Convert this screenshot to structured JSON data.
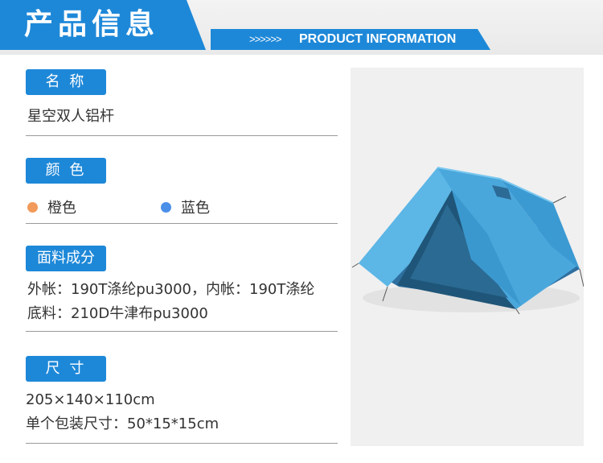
{
  "header": {
    "title": "产品信息",
    "arrows": ">>>>>>",
    "subtitle": "PRODUCT INFORMATION",
    "color": "#1e88d8"
  },
  "sections": {
    "name": {
      "label": "名 称",
      "value": "星空双人铝杆"
    },
    "color": {
      "label": "颜 色",
      "options": [
        {
          "name": "橙色",
          "swatch": "#f29a5a"
        },
        {
          "name": "蓝色",
          "swatch": "#4a8fe8"
        }
      ]
    },
    "fabric": {
      "label": "面料成分",
      "lines": [
        "外帐：190T涤纶pu3000，内帐：190T涤纶",
        "底料：210D牛津布pu3000"
      ]
    },
    "size": {
      "label": "尺 寸",
      "lines": [
        "205×140×110cm",
        "单个包装尺寸：50*15*15cm"
      ]
    }
  },
  "image": {
    "subject": "tent-photo",
    "tent_color": "#4aa8dc"
  }
}
